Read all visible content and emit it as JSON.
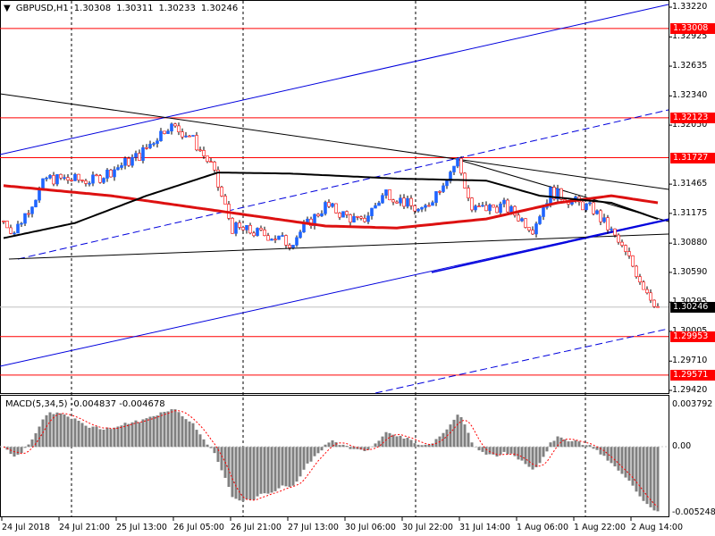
{
  "header": {
    "symbol": "GBPUSD,H1",
    "open": "1.30308",
    "high": "1.30311",
    "low": "1.30233",
    "close": "1.30246"
  },
  "macd_label": "MACD(5,34,5) -0.004837 -0.004678",
  "colors": {
    "level": "#ff0000",
    "bull": "#1e64ff",
    "ma_slow": "#dd1111",
    "ma_fast": "#000000",
    "channel": "#0000dd",
    "macd_hist": "#808080",
    "macd_signal": "#ff0000"
  },
  "price_axis": [
    "1.33220",
    "1.32925",
    "1.32635",
    "1.32340",
    "1.32050",
    "1.31465",
    "1.31175",
    "1.30880",
    "1.30590",
    "1.30295",
    "1.30005",
    "1.29710",
    "1.29420"
  ],
  "level_tags": [
    "1.33008",
    "1.32123",
    "1.31727",
    "1.29953",
    "1.29571"
  ],
  "current_price": "1.30246",
  "macd_axis": [
    "0.003792",
    "0.00",
    "-0.005248"
  ],
  "time_axis": [
    "24 Jul 2018",
    "24 Jul 21:00",
    "25 Jul 13:00",
    "26 Jul 05:00",
    "26 Jul 21:00",
    "27 Jul 13:00",
    "30 Jul 06:00",
    "30 Jul 22:00",
    "31 Jul 14:00",
    "1 Aug 06:00",
    "1 Aug 22:00",
    "2 Aug 14:00"
  ],
  "chart_data": {
    "type": "candlestick",
    "symbol": "GBPUSD",
    "timeframe": "H1",
    "ylim": [
      1.2942,
      1.3322
    ],
    "macd_ylim": [
      -0.005248,
      0.003792
    ],
    "bars": 184,
    "price_path": [
      [
        0,
        1.311
      ],
      [
        3,
        1.3099
      ],
      [
        12,
        1.3152
      ],
      [
        25,
        1.315
      ],
      [
        38,
        1.3175
      ],
      [
        46,
        1.3205
      ],
      [
        52,
        1.3195
      ],
      [
        58,
        1.3165
      ],
      [
        64,
        1.3103
      ],
      [
        75,
        1.3095
      ],
      [
        80,
        1.3088
      ],
      [
        90,
        1.3125
      ],
      [
        100,
        1.3108
      ],
      [
        107,
        1.3139
      ],
      [
        117,
        1.3118
      ],
      [
        127,
        1.317
      ],
      [
        131,
        1.3121
      ],
      [
        140,
        1.3125
      ],
      [
        148,
        1.3103
      ],
      [
        153,
        1.3139
      ],
      [
        165,
        1.3121
      ],
      [
        170,
        1.3099
      ],
      [
        175,
        1.3072
      ],
      [
        179,
        1.3046
      ],
      [
        183,
        1.30246
      ]
    ],
    "ma_slow": [
      [
        0,
        1.3145
      ],
      [
        30,
        1.3135
      ],
      [
        60,
        1.312
      ],
      [
        90,
        1.3105
      ],
      [
        110,
        1.3103
      ],
      [
        135,
        1.3112
      ],
      [
        155,
        1.3128
      ],
      [
        170,
        1.3135
      ],
      [
        183,
        1.3128
      ]
    ],
    "ma_fast": [
      [
        0,
        1.3093
      ],
      [
        20,
        1.3108
      ],
      [
        40,
        1.3135
      ],
      [
        60,
        1.3158
      ],
      [
        80,
        1.3157
      ],
      [
        110,
        1.3152
      ],
      [
        135,
        1.315
      ],
      [
        150,
        1.3135
      ],
      [
        170,
        1.3128
      ],
      [
        183,
        1.3112
      ]
    ]
  }
}
